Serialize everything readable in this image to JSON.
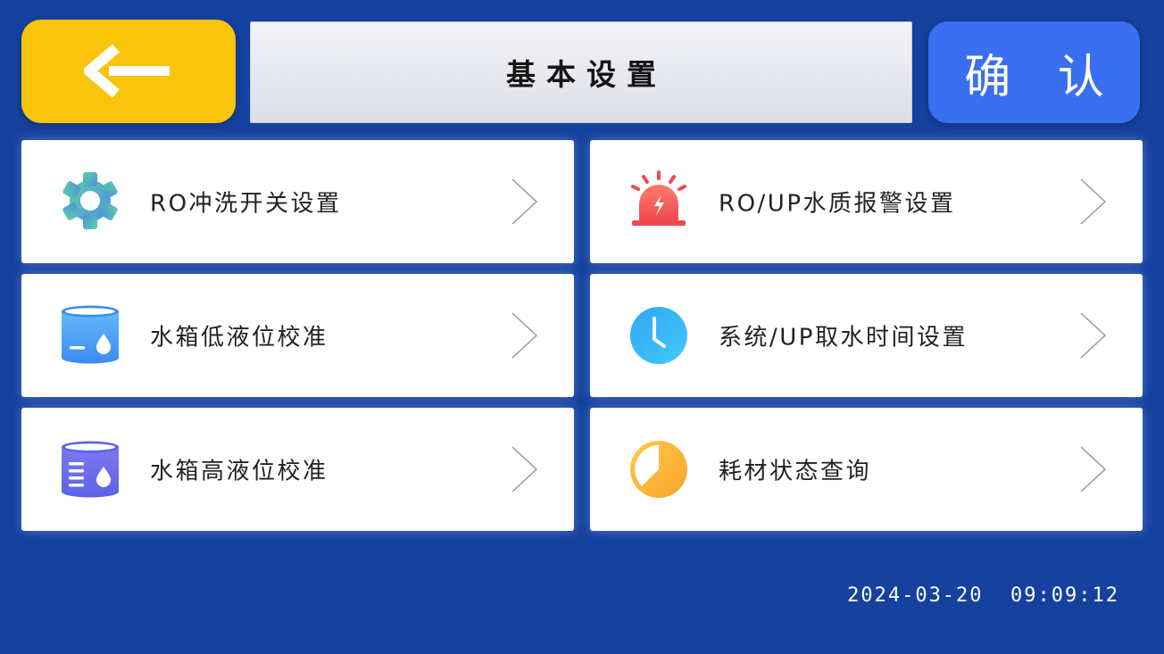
{
  "header": {
    "back_icon": "arrow-left-icon",
    "title": "基本设置",
    "confirm_label": "确 认"
  },
  "menu": [
    {
      "label": "RO冲洗开关设置",
      "icon": "gear-icon"
    },
    {
      "label": "RO/UP水质报警设置",
      "icon": "alarm-icon"
    },
    {
      "label": "水箱低液位校准",
      "icon": "water-tank-low-icon"
    },
    {
      "label": "系统/UP取水时间设置",
      "icon": "clock-icon"
    },
    {
      "label": "水箱高液位校准",
      "icon": "water-tank-high-icon"
    },
    {
      "label": "耗材状态查询",
      "icon": "pie-status-icon"
    }
  ],
  "status": {
    "datetime": "2024-03-20  09:09:12"
  },
  "colors": {
    "background": "#15419f",
    "back_button": "#fac40b",
    "confirm_button": "#3a6ff1"
  }
}
